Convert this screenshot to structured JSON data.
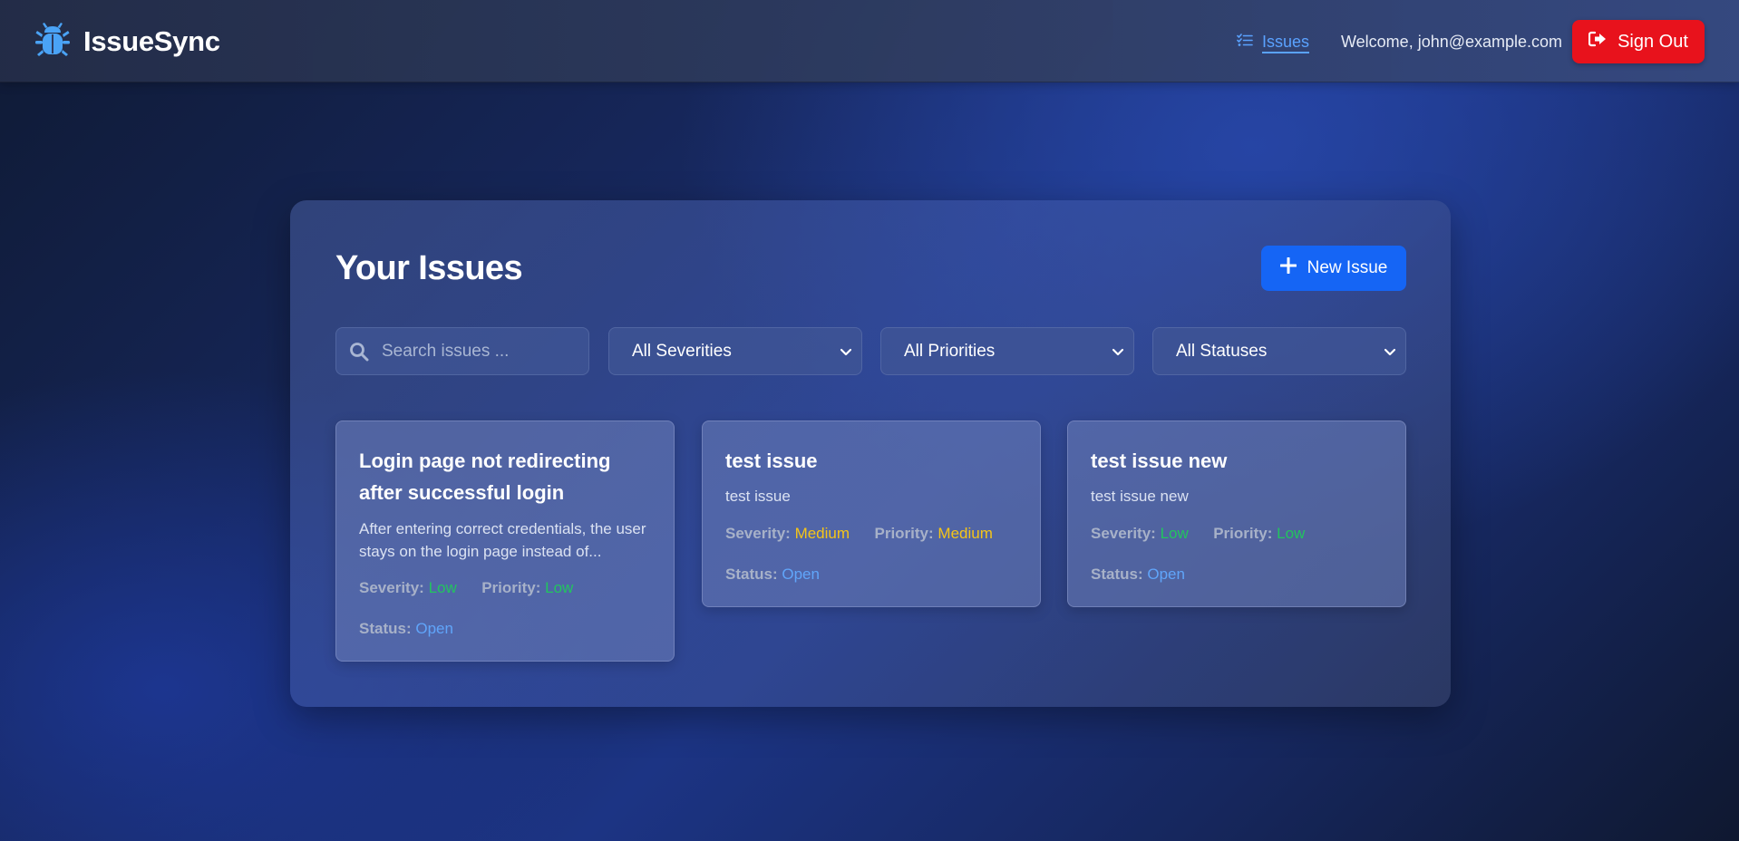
{
  "app": {
    "name": "IssueSync"
  },
  "nav": {
    "issues_label": "Issues"
  },
  "user": {
    "welcome": "Welcome, john@example.com"
  },
  "actions": {
    "signout_label": "Sign Out",
    "new_issue_label": "New Issue"
  },
  "main": {
    "title": "Your Issues"
  },
  "filters": {
    "search_placeholder": "Search issues ...",
    "severity_selected": "All Severities",
    "priority_selected": "All Priorities",
    "status_selected": "All Statuses"
  },
  "labels": {
    "severity": "Severity:",
    "priority": "Priority:",
    "status": "Status:"
  },
  "issues": [
    {
      "title": "Login page not redirecting after successful login",
      "description": "After entering correct credentials, the user stays on the login page instead of...",
      "severity": "Low",
      "priority": "Low",
      "status": "Open"
    },
    {
      "title": "test issue",
      "description": "test issue",
      "severity": "Medium",
      "priority": "Medium",
      "status": "Open"
    },
    {
      "title": "test issue new",
      "description": "test issue new",
      "severity": "Low",
      "priority": "Low",
      "status": "Open"
    }
  ],
  "colors": {
    "accent": "#1565f5",
    "signout": "#e8121c",
    "nav_link": "#5aa2ff",
    "low": "#22c55e",
    "medium": "#f5c518",
    "open": "#60a5fa"
  },
  "icons": {
    "logo": "bug-icon",
    "nav": "list-check-icon",
    "signout": "sign-out-icon",
    "new_issue": "plus-icon",
    "search": "search-icon",
    "select": "chevron-down-icon"
  }
}
